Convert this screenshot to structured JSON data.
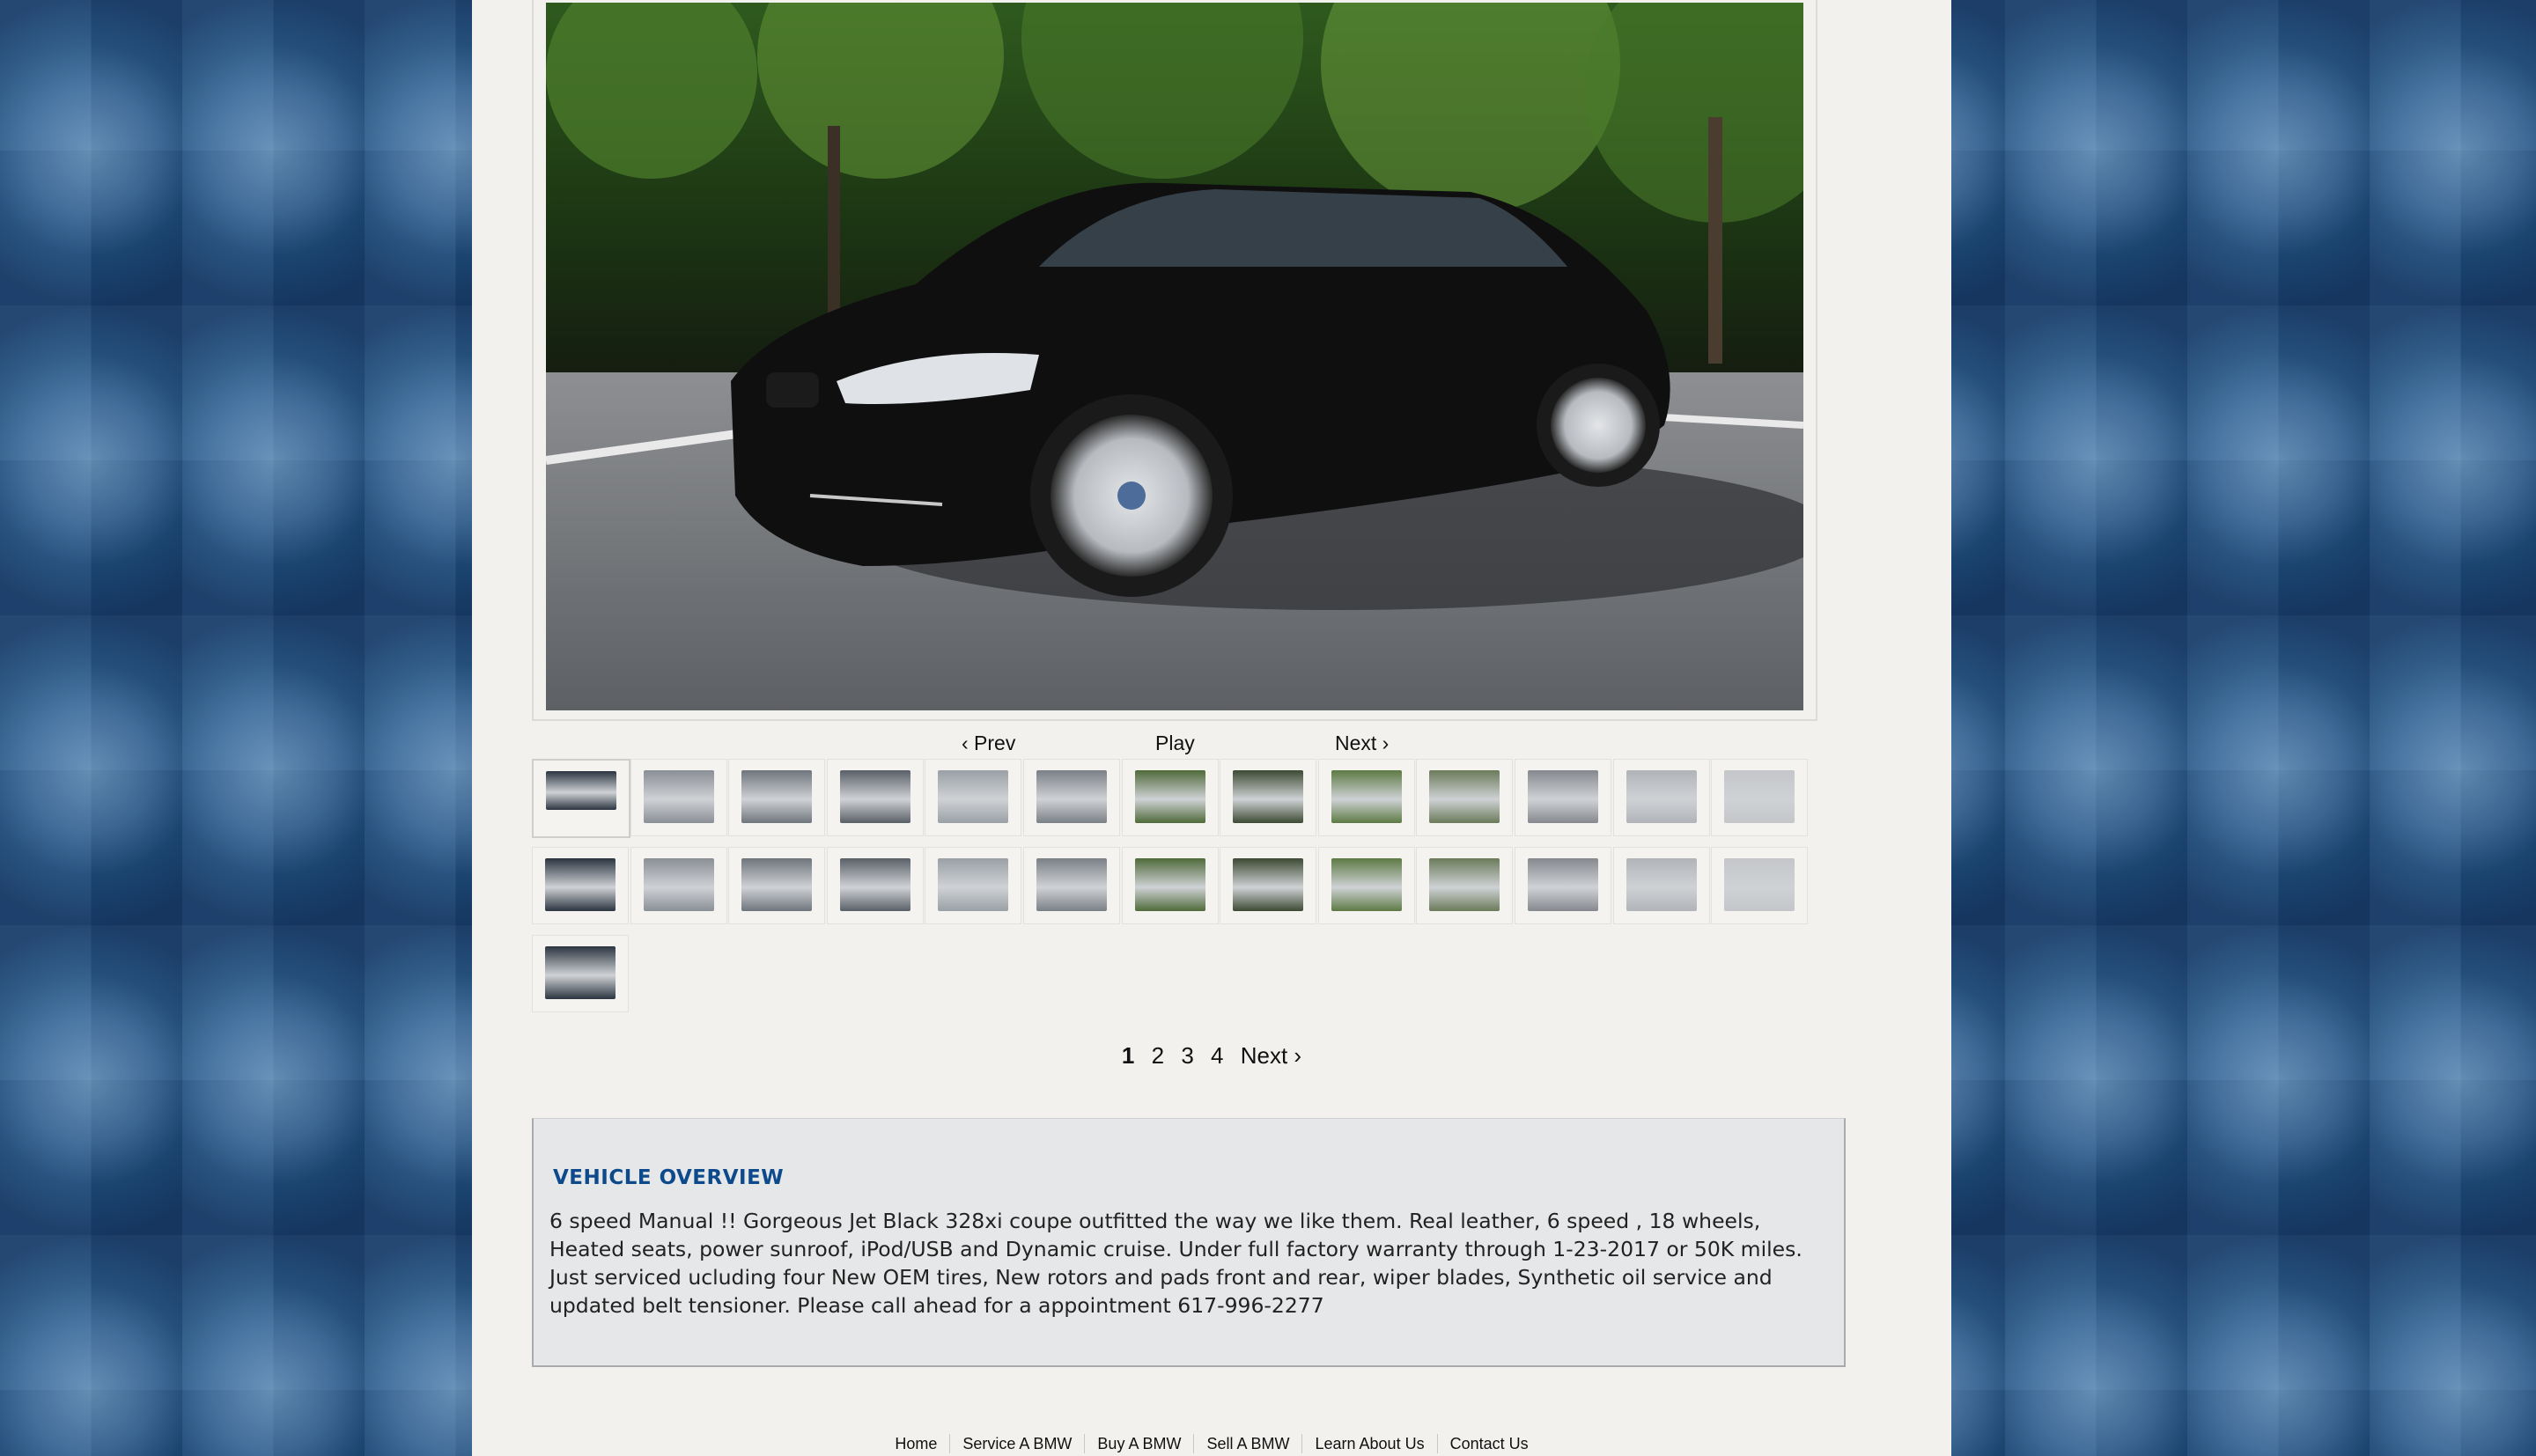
{
  "gallery": {
    "main_photo_icon": "car-photo",
    "controls": {
      "prev": "‹ Prev",
      "play": "Play",
      "next": "Next ›"
    },
    "thumbnail_count": 27
  },
  "pagination": {
    "pages": [
      "1",
      "2",
      "3",
      "4"
    ],
    "current": "1",
    "next": "Next ›"
  },
  "overview": {
    "title": "VEHICLE OVERVIEW",
    "text": "6 speed Manual !! Gorgeous Jet Black 328xi coupe outfitted the way we like them. Real leather, 6 speed , 18 wheels, Heated seats, power sunroof, iPod/USB and Dynamic cruise. Under full factory warranty through 1-23-2017 or 50K miles. Just serviced ucluding four New OEM tires, New rotors and pads front and rear, wiper blades, Synthetic oil service and updated belt tensioner. Please call ahead for a appointment 617-996-2277"
  },
  "footer": {
    "links": [
      "Home",
      "Service A BMW",
      "Buy A BMW",
      "Sell A BMW",
      "Learn About Us",
      "Contact Us"
    ]
  },
  "colors": {
    "page_bg": "#f2f1ee",
    "overview_title": "#0d4a8c",
    "body_bg": "#1f4f80"
  }
}
